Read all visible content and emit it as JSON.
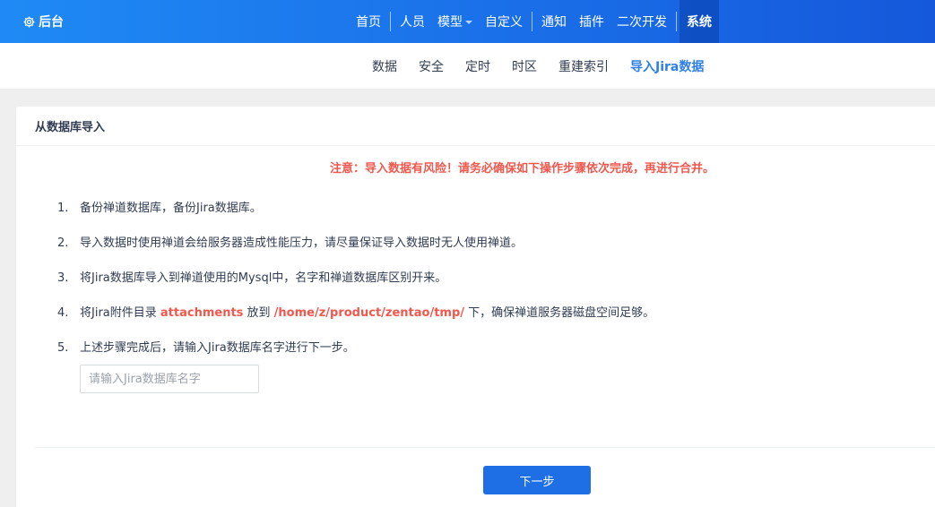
{
  "topbar": {
    "brand_label": "后台",
    "nav": [
      {
        "label": "首页"
      },
      {
        "label": "人员"
      },
      {
        "label": "模型"
      },
      {
        "label": "自定义"
      },
      {
        "label": "通知"
      },
      {
        "label": "插件"
      },
      {
        "label": "二次开发"
      },
      {
        "label": "系统",
        "active": true
      }
    ]
  },
  "subnav": {
    "items": [
      {
        "label": "数据"
      },
      {
        "label": "安全"
      },
      {
        "label": "定时"
      },
      {
        "label": "时区"
      },
      {
        "label": "重建索引"
      },
      {
        "label": "导入Jira数据",
        "active": true
      }
    ]
  },
  "panel": {
    "title": "从数据库导入",
    "warning": "注意：导入数据有风险！请务必确保如下操作步骤依次完成，再进行合并。",
    "steps": [
      {
        "num": "1.",
        "text": "备份禅道数据库，备份Jira数据库。"
      },
      {
        "num": "2.",
        "text": "导入数据时使用禅道会给服务器造成性能压力，请尽量保证导入数据时无人使用禅道。"
      },
      {
        "num": "3.",
        "text": "将Jira数据库导入到禅道使用的Mysql中，名字和禅道数据库区别开来。"
      },
      {
        "num": "4.",
        "text_before": "将Jira附件目录 ",
        "attachments": "attachments",
        "text_mid": " 放到 ",
        "path": "/home/z/product/zentao/tmp/",
        "text_after": " 下，确保禅道服务器磁盘空间足够。"
      },
      {
        "num": "5.",
        "text": "上述步骤完成后，请输入Jira数据库名字进行下一步。"
      }
    ],
    "db_input": {
      "placeholder": "请输入Jira数据库名字",
      "value": ""
    },
    "next_button": "下一步"
  },
  "colors": {
    "topbar_start": "#1f8af5",
    "topbar_end": "#1558db",
    "accent": "#1e6fe6",
    "warning": "#f0574d"
  }
}
